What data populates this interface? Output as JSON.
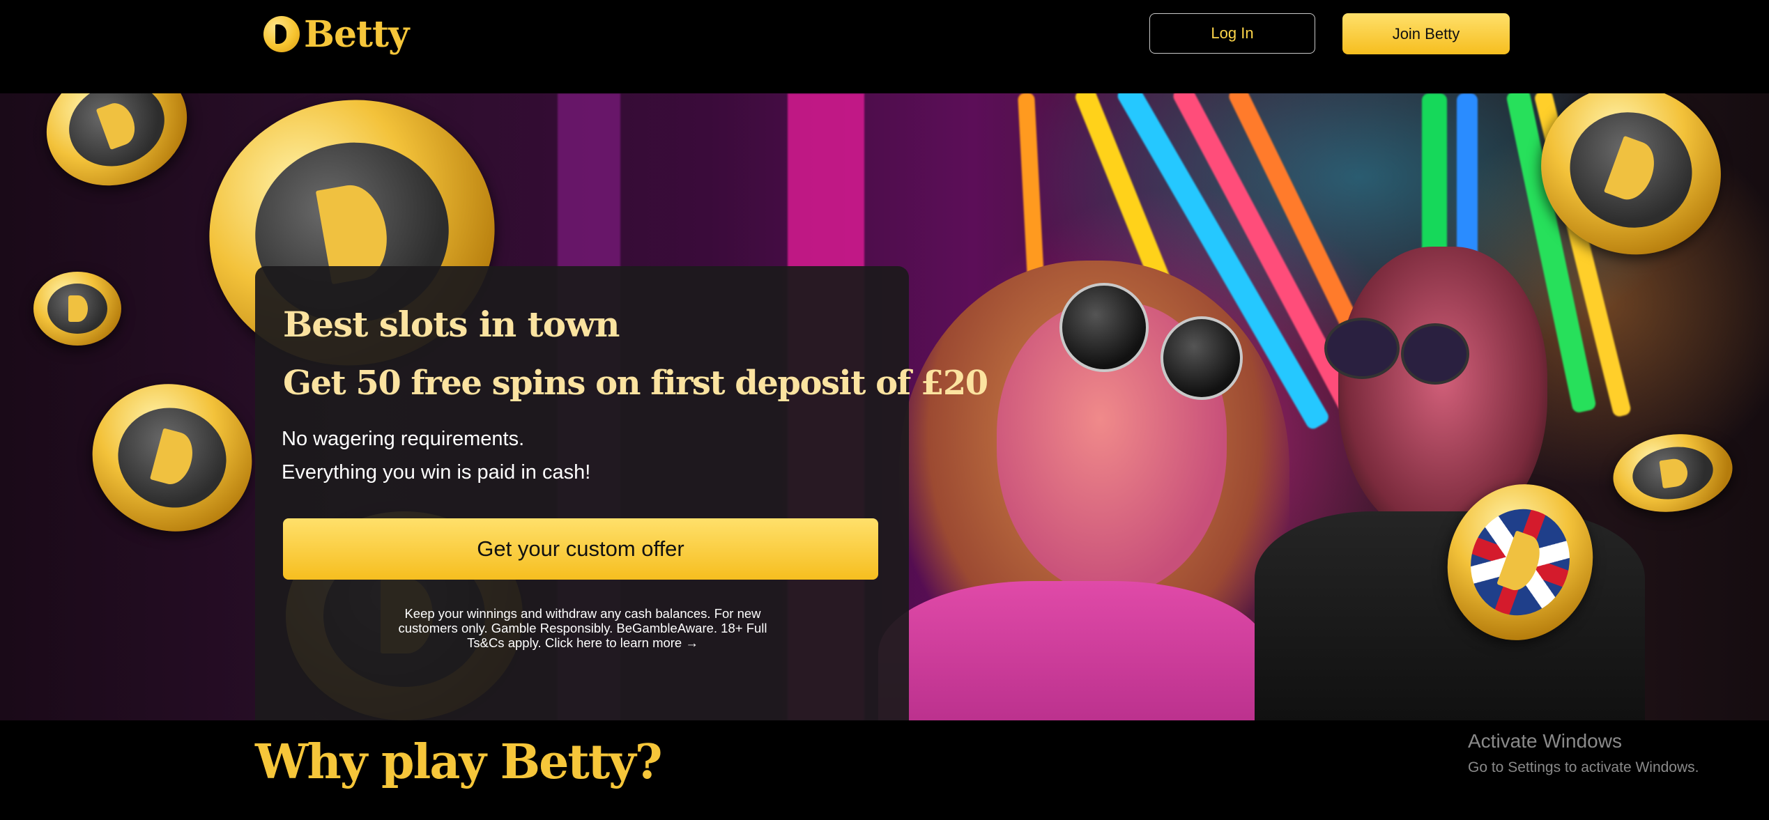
{
  "header": {
    "logo_text": "Betty",
    "login_label": "Log In",
    "join_label": "Join Betty"
  },
  "hero": {
    "title": "Best slots in town",
    "subtitle": "Get 50 free spins on first deposit of £20",
    "line1": "No wagering requirements.",
    "line2": "Everything you win is paid in cash!",
    "cta_label": "Get your custom offer",
    "terms_text": "Keep your winnings and withdraw any cash balances. For new customers only. Gamble Responsibly. BeGambleAware. 18+ Full Ts&Cs apply.",
    "terms_link": "Click here to learn more →",
    "image": "hero-photo-couple-neon-with-gold-coins"
  },
  "section": {
    "heading": "Why play Betty?"
  },
  "os_overlay": {
    "title": "Activate Windows",
    "subtitle": "Go to Settings to activate Windows."
  },
  "colors": {
    "brand_gold": "#f6c63a",
    "headline_cream": "#fbe3a0",
    "background": "#000000",
    "card_bg": "#1c1a1c"
  },
  "icons": {
    "logo": "betty-logo-icon"
  }
}
